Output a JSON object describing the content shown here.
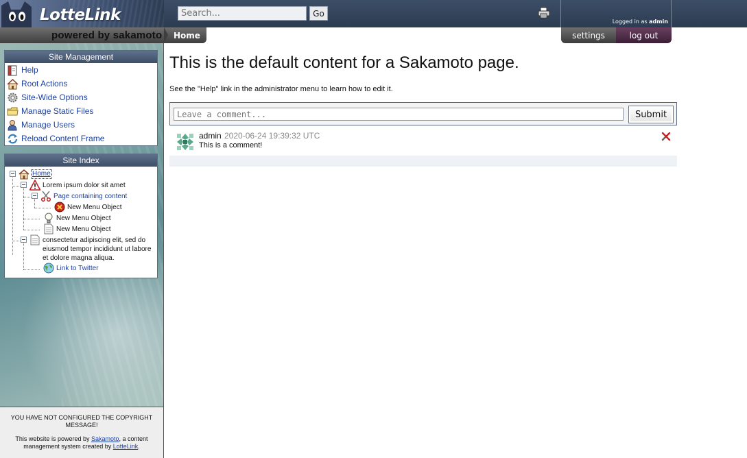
{
  "brand": {
    "name": "LotteLink",
    "tagline": "powered by sakamoto"
  },
  "search": {
    "placeholder": "Search...",
    "go_label": "Go"
  },
  "login": {
    "prefix": "Logged in as",
    "user": "admin"
  },
  "tabs": {
    "home": "Home",
    "settings": "settings",
    "logout": "log out"
  },
  "sidebar": {
    "management_title": "Site Management",
    "management_items": [
      {
        "label": "Help",
        "icon": "book-icon"
      },
      {
        "label": "Root Actions",
        "icon": "house-icon"
      },
      {
        "label": "Site-Wide Options",
        "icon": "gear-icon"
      },
      {
        "label": "Manage Static Files",
        "icon": "folder-icon"
      },
      {
        "label": "Manage Users",
        "icon": "user-icon"
      },
      {
        "label": "Reload Content Frame",
        "icon": "refresh-icon"
      }
    ],
    "index_title": "Site Index",
    "tree": [
      {
        "label": "Home",
        "icon": "house-icon"
      },
      {
        "label": "Lorem ipsum dolor sit amet",
        "icon": "warning-icon"
      },
      {
        "label": "Page containing content",
        "icon": "scissors-icon"
      },
      {
        "label": "New Menu Object",
        "icon": "error-icon"
      },
      {
        "label": "New Menu Object",
        "icon": "lightbulb-icon"
      },
      {
        "label": "New Menu Object",
        "icon": "page-icon"
      },
      {
        "label": "consectetur adipiscing elit, sed do eiusmod tempor incididunt ut labore et dolore magna aliqua.",
        "icon": "page-icon"
      },
      {
        "label": "Link to Twitter",
        "icon": "globe-icon"
      }
    ]
  },
  "footer": {
    "copyright_warning": "YOU HAVE NOT CONFIGURED THE COPYRIGHT MESSAGE!",
    "powered_prefix": "This website is powered by",
    "powered_link": "Sakamoto",
    "powered_mid": ", a content management system created by",
    "powered_link2": "LotteLink",
    "powered_suffix": "."
  },
  "content": {
    "title": "This is the default content for a Sakamoto page.",
    "text": "See the \"Help\" link in the administrator menu to learn how to edit it."
  },
  "comments": {
    "input_placeholder": "Leave a comment...",
    "submit_label": "Submit",
    "items": [
      {
        "author": "admin",
        "date": "2020-06-24 19:39:32 UTC",
        "text": "This is a comment!"
      }
    ]
  },
  "colors": {
    "header": "#34465e",
    "link": "#1b3fa0",
    "logout_tab": "#5a2f4f"
  }
}
